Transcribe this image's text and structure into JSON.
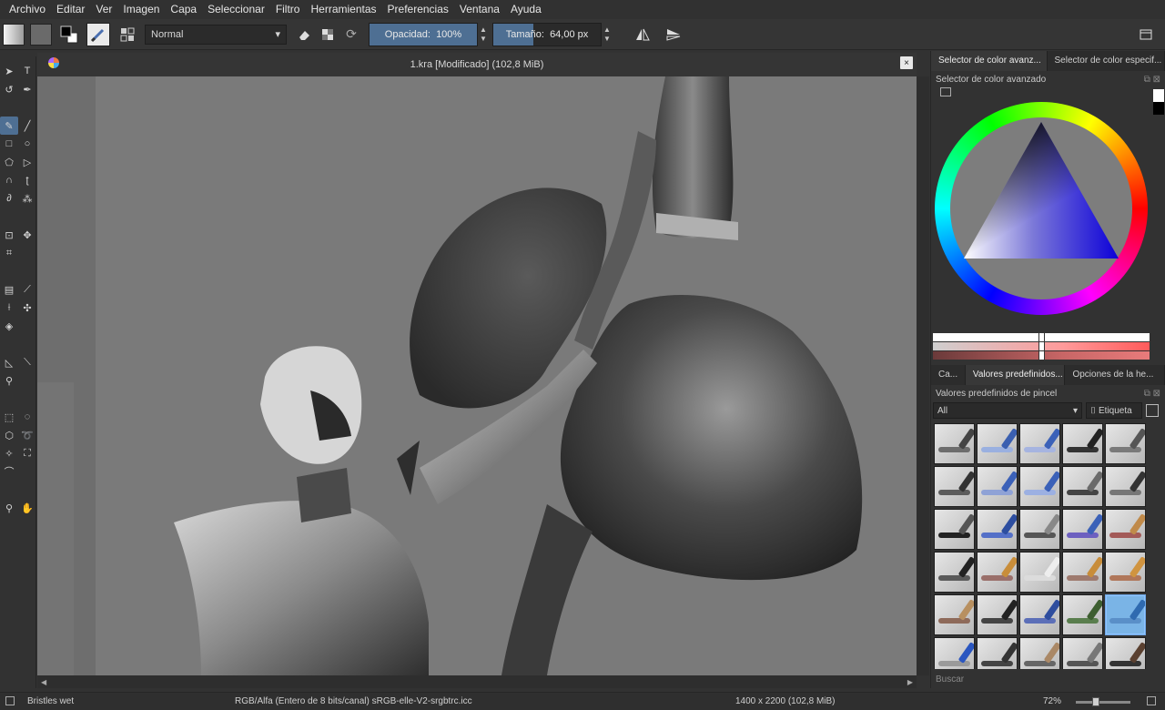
{
  "menu": [
    "Archivo",
    "Editar",
    "Ver",
    "Imagen",
    "Capa",
    "Seleccionar",
    "Filtro",
    "Herramientas",
    "Preferencias",
    "Ventana",
    "Ayuda"
  ],
  "toolbar": {
    "blend_mode": "Normal",
    "opacity_label": "Opacidad:",
    "opacity_value": "100%",
    "opacity_fraction": 1.0,
    "size_label": "Tamaño:",
    "size_value": "64,00 px",
    "size_fraction": 0.37
  },
  "document": {
    "title": "1.kra [Modificado]  (102,8 MiB)",
    "close": "×"
  },
  "docker": {
    "color_tabs": [
      "Selector de color avanz...",
      "Selector de color especif..."
    ],
    "color_panel_title": "Selector de color avanzado",
    "preset_tabs": [
      "Ca...",
      "Valores predefinidos...",
      "Opciones de la he..."
    ],
    "preset_panel_title": "Valores predefinidos de pincel",
    "filter_value": "All",
    "tag_label": "Etiqueta",
    "search_placeholder": "Buscar"
  },
  "brushes": [
    {
      "stroke": "#6d6d6d",
      "nib": "#444"
    },
    {
      "stroke": "#9ab0e0",
      "nib": "#3a5fb0"
    },
    {
      "stroke": "#a6b4e0",
      "nib": "#3b61b8"
    },
    {
      "stroke": "#333",
      "nib": "#222"
    },
    {
      "stroke": "#7a7a7a",
      "nib": "#555"
    },
    {
      "stroke": "#5c5c5c",
      "nib": "#333"
    },
    {
      "stroke": "#8fa2d6",
      "nib": "#3b61b8"
    },
    {
      "stroke": "#9cb0e2",
      "nib": "#3b61b8"
    },
    {
      "stroke": "#444",
      "nib": "#6a6a6a"
    },
    {
      "stroke": "#777",
      "nib": "#333"
    },
    {
      "stroke": "#222",
      "nib": "#555"
    },
    {
      "stroke": "#5470c8",
      "nib": "#2d4ea0"
    },
    {
      "stroke": "#555",
      "nib": "#888"
    },
    {
      "stroke": "#6d60c0",
      "nib": "#3b61b8"
    },
    {
      "stroke": "#a35a58",
      "nib": "#c08a4a"
    },
    {
      "stroke": "#5a5a5a",
      "nib": "#222"
    },
    {
      "stroke": "#9a6f6a",
      "nib": "#c88d3a"
    },
    {
      "stroke": "#dcdcdc",
      "nib": "#eee"
    },
    {
      "stroke": "#9e7a6e",
      "nib": "#c88d3a"
    },
    {
      "stroke": "#b0775a",
      "nib": "#d09440"
    },
    {
      "stroke": "#8e6a5a",
      "nib": "#b89060"
    },
    {
      "stroke": "#444",
      "nib": "#222"
    },
    {
      "stroke": "#5c6fb8",
      "nib": "#2e4d9e"
    },
    {
      "stroke": "#5a7e4e",
      "nib": "#3d5e30"
    },
    {
      "stroke": "#5a8fc8",
      "nib": "#2f6ab0"
    },
    {
      "stroke": "#9a9a9a",
      "nib": "#2a56c0"
    },
    {
      "stroke": "#444",
      "nib": "#333"
    },
    {
      "stroke": "#666",
      "nib": "#aa8866"
    },
    {
      "stroke": "#555",
      "nib": "#777"
    },
    {
      "stroke": "#333",
      "nib": "#5a4030"
    }
  ],
  "selected_brush_index": 24,
  "status": {
    "brush_name": "Bristles wet",
    "color_space": "RGB/Alfa (Entero de 8 bits/canal)  sRGB-elle-V2-srgbtrc.icc",
    "dimensions": "1400 x 2200 (102,8 MiB)",
    "zoom": "72%"
  }
}
